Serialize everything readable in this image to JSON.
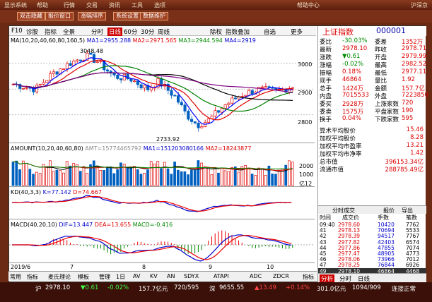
{
  "topbar": {
    "items": [
      "显示系统",
      "帮助",
      "行情",
      "交易",
      "资讯",
      "工具",
      "选项",
      "帮助中心"
    ],
    "right": "沪深京"
  },
  "toolbar": {
    "buttons": [
      "双击隐藏",
      "报价窗口",
      "涨幅排序",
      "系统设置",
      "数据维护"
    ]
  },
  "tabs": [
    "F10",
    "诊股",
    "指标",
    "全景",
    "分时",
    "日线",
    "60分",
    "30分",
    "周线",
    "除权",
    "指数叠加",
    "自选",
    "更多"
  ],
  "active_tab": "日线",
  "ma_legend": {
    "label": "MA",
    "params": "(10,20,40,60,80,160,5)",
    "ma1": "MA1=2955.288",
    "ma2": "MA2=2971.565",
    "ma3": "MA3=2944.594",
    "ma4": "MA4=2919"
  },
  "price_labels": {
    "high": "3048.48",
    "low": "2733.92"
  },
  "price_axis": [
    "3000",
    "2900",
    "2800"
  ],
  "amount_legend": {
    "label": "AMOUNT",
    "params": "(10,20,40,60,80)",
    "amt": "AMT=15774465792",
    "ma1": "MA1=151203080166",
    "ma2": "MA2=18243877"
  },
  "amount_axis": [
    "2000",
    "1000",
    "亿12"
  ],
  "kd_legend": {
    "label": "KD",
    "params": "(40,3,3)",
    "k": "K=77.142",
    "d": "D=74.667"
  },
  "macd_legend": {
    "label": "MACD",
    "params": "(40,20,10)",
    "dif": "DIF=13.447",
    "dea": "DEA=13.655",
    "macd": "MACD=-0.416"
  },
  "x_axis": [
    "2019/6",
    "7",
    "8",
    "9",
    "10"
  ],
  "bottombar": [
    "常用",
    "指标",
    "",
    "麦氏理论",
    "模板",
    "",
    "管理",
    "1日",
    "AV",
    "KV",
    "AN",
    "SDYX",
    "ATAPI",
    "ADC",
    "ZDCR",
    "指标分享"
  ],
  "index": {
    "name": "上证指数",
    "code": "000001",
    "rows": [
      [
        "委比",
        "-30.03%",
        "委差",
        "1352万"
      ],
      [
        "最新",
        "2978.10",
        "昨收",
        "2978.71"
      ],
      [
        "涨跌",
        "▼0.61",
        "开盘",
        "2979.99"
      ],
      [
        "涨幅",
        "-0.02%",
        "最高",
        "2982.52"
      ],
      [
        "振幅",
        "0.18%",
        "最低",
        "2977.11"
      ],
      [
        "现手",
        "46864",
        "量比",
        "1.92"
      ],
      [
        "总手",
        "1424万",
        "金额",
        "157.7亿"
      ],
      [
        "内盘",
        "7015533",
        "外盘",
        "7223850"
      ],
      [
        "委买",
        "2928万",
        "上涨家数",
        "720"
      ],
      [
        "委卖",
        "1575万",
        "平盘家数",
        "190"
      ],
      [
        "换手",
        "0.04%",
        "下跌家数",
        "595"
      ]
    ],
    "stats": [
      [
        "算术平均股价",
        "15.46"
      ],
      [
        "加权平均股价",
        "8.28"
      ],
      [
        "加权平均市盈率",
        "13.21"
      ],
      [
        "加权平均市净率",
        "1.42"
      ],
      [
        "总市值",
        "396153.34亿"
      ],
      [
        "流通市值",
        "288785.49亿"
      ]
    ],
    "tick_tabs": [
      "分时成交",
      "报价",
      "导出"
    ],
    "tick_header": [
      "时间",
      "成交价",
      "手数",
      "笔数"
    ],
    "ticks": [
      [
        "09:40",
        "2978.60",
        "10420",
        "7762"
      ],
      [
        "41",
        "2978.13",
        "70694",
        "5533"
      ],
      [
        "42",
        "2978.39",
        "94517",
        "7767"
      ],
      [
        "43",
        "2977.82",
        "42403",
        "6574"
      ],
      [
        "44",
        "2977.86",
        "47855",
        "7074"
      ],
      [
        "45",
        "2977.47",
        "48905",
        "4773"
      ],
      [
        "46",
        "2978.06",
        "73966",
        "7012"
      ],
      [
        "47",
        "2978.25",
        "76844",
        "6926"
      ],
      [
        "49",
        "2978.10",
        "46864",
        "4468"
      ]
    ],
    "right_tabs": [
      "分析",
      "分时",
      "日线"
    ]
  },
  "status": {
    "items": [
      "沪",
      "2978.10",
      "▼0.61",
      "-0.02%",
      "157.7亿元",
      "720/595",
      "深",
      "9655.55",
      "▲13.49",
      "+0.14%",
      "301.0亿元",
      "1094/909",
      "连接正常"
    ]
  },
  "colors": {
    "up": "#e00000",
    "down": "#0060c0",
    "ma1": "#000000",
    "ma2": "#e00000",
    "ma3": "#008000",
    "ma4": "#0000ff",
    "bg": "#ffffff"
  }
}
